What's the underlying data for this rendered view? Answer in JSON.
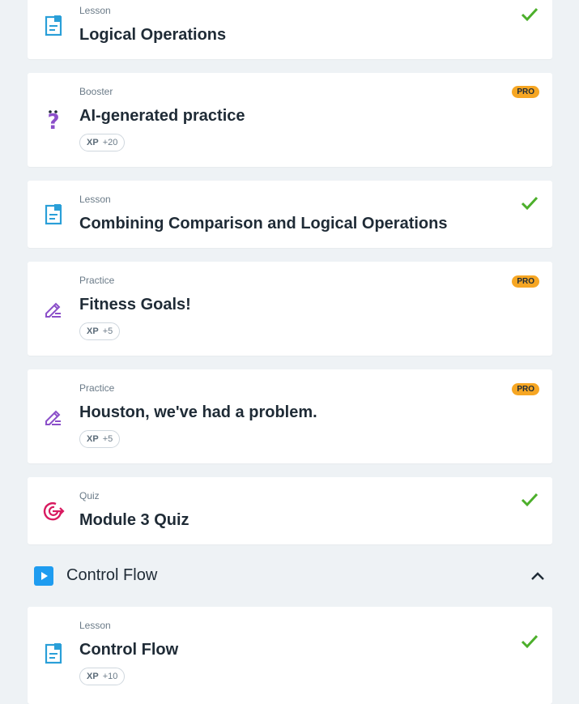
{
  "cards": [
    {
      "type": "Lesson",
      "title": "Logical Operations",
      "status": "completed"
    },
    {
      "type": "Booster",
      "title": "AI-generated practice",
      "badge": "PRO",
      "xp_label": "XP",
      "xp_value": "+20"
    },
    {
      "type": "Lesson",
      "title": "Combining Comparison and Logical Operations",
      "status": "completed"
    },
    {
      "type": "Practice",
      "title": "Fitness Goals!",
      "badge": "PRO",
      "xp_label": "XP",
      "xp_value": "+5"
    },
    {
      "type": "Practice",
      "title": "Houston, we've had a problem.",
      "badge": "PRO",
      "xp_label": "XP",
      "xp_value": "+5"
    },
    {
      "type": "Quiz",
      "title": "Module 3 Quiz",
      "status": "completed"
    },
    {
      "type": "Lesson",
      "title": "Control Flow",
      "status": "completed",
      "xp_label": "XP",
      "xp_value": "+10"
    }
  ],
  "section": {
    "title": "Control Flow",
    "icon": "play-icon",
    "toggle_icon": "chevron-up-icon"
  },
  "colors": {
    "lesson_icon": "#2a9fd8",
    "practice_icon": "#8b4fc9",
    "quiz_icon": "#d81b60",
    "check": "#4caf2b",
    "pro_badge": "#f6a623"
  }
}
